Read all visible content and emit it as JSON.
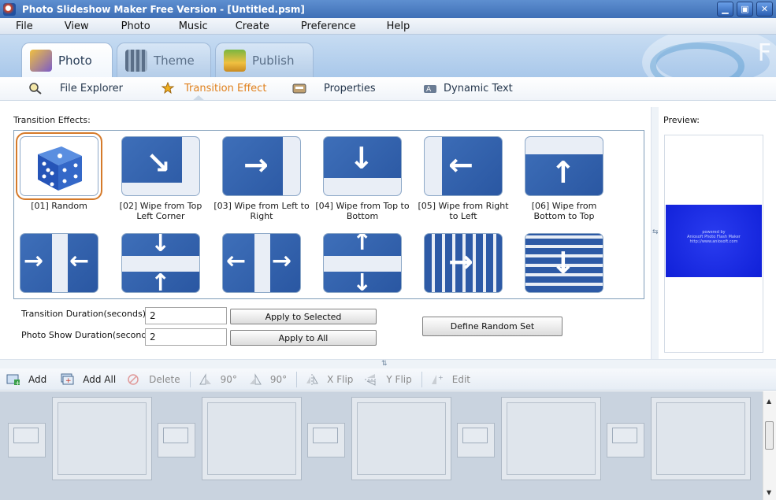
{
  "window": {
    "title": "Photo Slideshow Maker Free Version - [Untitled.psm]",
    "buttons": [
      "minimize",
      "maximize",
      "close"
    ]
  },
  "menu": [
    "File",
    "View",
    "Photo",
    "Music",
    "Create",
    "Preference",
    "Help"
  ],
  "banner": {
    "letter": "F"
  },
  "main_tabs": [
    {
      "label": "Photo",
      "active": true,
      "icon": "photo-album-icon"
    },
    {
      "label": "Theme",
      "active": false,
      "icon": "film-icon"
    },
    {
      "label": "Publish",
      "active": false,
      "icon": "gift-box-icon"
    }
  ],
  "sub_tabs": [
    {
      "label": "File Explorer",
      "active": false,
      "icon": "magnifier-icon"
    },
    {
      "label": "Transition Effect",
      "active": true,
      "icon": "star-wand-icon"
    },
    {
      "label": "Properties",
      "active": false,
      "icon": "properties-icon"
    },
    {
      "label": "Dynamic Text",
      "active": false,
      "icon": "text-tool-icon"
    }
  ],
  "effects_panel": {
    "label": "Transition Effects:",
    "effects": [
      {
        "name": "[01] Random",
        "icon": "dice-icon",
        "selected": true
      },
      {
        "name": "[02] Wipe from Top Left Corner",
        "icon": "arrow-down-right-icon",
        "selected": false
      },
      {
        "name": "[03] Wipe from Left to Right",
        "icon": "arrow-right-icon",
        "selected": false
      },
      {
        "name": "[04] Wipe from Top to Bottom",
        "icon": "arrow-down-icon",
        "selected": false
      },
      {
        "name": "[05] Wipe from Right to Left",
        "icon": "arrow-left-icon",
        "selected": false
      },
      {
        "name": "[06] Wipe from Bottom to Top",
        "icon": "arrow-up-icon",
        "selected": false
      }
    ],
    "second_row_icons": [
      "arrows-inward-horizontal-icon",
      "arrows-inward-vertical-icon",
      "arrows-outward-horizontal-icon",
      "arrows-outward-vertical-icon",
      "vertical-blinds-icon",
      "horizontal-blinds-icon"
    ]
  },
  "controls": {
    "transition_duration_label": "Transition Duration(seconds):",
    "transition_duration_value": "2",
    "apply_selected": "Apply to Selected",
    "photo_show_label": "Photo Show Duration(seconds):",
    "photo_show_value": "2",
    "apply_all": "Apply to All",
    "define_random": "Define Random Set"
  },
  "preview": {
    "label": "Preview:",
    "lines": [
      "powered by",
      "Aniosoft Photo Flash Maker",
      "http://www.aniosoft.com"
    ]
  },
  "toolbar": {
    "add": "Add",
    "add_all": "Add All",
    "delete": "Delete",
    "rotate_left": "90°",
    "rotate_right": "90°",
    "x_flip": "X Flip",
    "y_flip": "Y Flip",
    "edit": "Edit"
  }
}
